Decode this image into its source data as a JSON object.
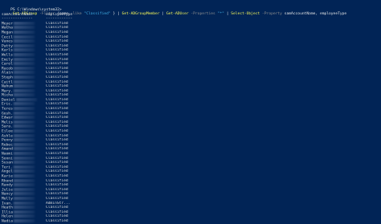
{
  "command": {
    "prompt": "PS C:\\Windows\\system32>",
    "tokens": [
      {
        "t": "cmd",
        "v": "Get-ADGroup"
      },
      {
        "t": "param",
        "v": "-Filter"
      },
      {
        "t": "op",
        "v": "{name"
      },
      {
        "t": "param",
        "v": "-like"
      },
      {
        "t": "str",
        "v": "\"Classified\""
      },
      {
        "t": "op",
        "v": "} |"
      },
      {
        "t": "cmd",
        "v": "Get-ADGroupMember"
      },
      {
        "t": "op",
        "v": "|"
      },
      {
        "t": "cmd",
        "v": "Get-ADUser"
      },
      {
        "t": "param",
        "v": "-Properties"
      },
      {
        "t": "str",
        "v": "\"*\""
      },
      {
        "t": "op",
        "v": "|"
      },
      {
        "t": "cmd",
        "v": "Select-Object"
      },
      {
        "t": "param",
        "v": "-Property"
      },
      {
        "t": "text",
        "v": "samAccountName, employeeType"
      }
    ]
  },
  "table": {
    "headers": [
      "samAccountName",
      "employeeType"
    ],
    "underline": [
      "--------------",
      "------------"
    ],
    "rows": [
      {
        "name": "Meyer",
        "type": "Classified"
      },
      {
        "name": "Watha",
        "type": "Classified"
      },
      {
        "name": "Megan",
        "type": "Classified"
      },
      {
        "name": "Cecil",
        "type": "Classified"
      },
      {
        "name": "Vanes",
        "type": "Classified"
      },
      {
        "name": "Patty",
        "type": "Classified"
      },
      {
        "name": "Karls",
        "type": "Classified"
      },
      {
        "name": "Wells",
        "type": "Classified"
      },
      {
        "name": "Emily",
        "type": "Classified"
      },
      {
        "name": "Carol",
        "type": "Classified"
      },
      {
        "name": "Racob",
        "type": "Classified"
      },
      {
        "name": "Alain",
        "type": "Classified"
      },
      {
        "name": "Steph",
        "type": "Classified"
      },
      {
        "name": "Caitl",
        "type": "Classified"
      },
      {
        "name": "Nahum",
        "type": "Classified"
      },
      {
        "name": "Mary.",
        "type": "Classified"
      },
      {
        "name": "Micha",
        "type": "Classified"
      },
      {
        "name": "Daniel",
        "type": "Classified"
      },
      {
        "name": "Eric.",
        "type": "Classified"
      },
      {
        "name": "Teres",
        "type": "Classified"
      },
      {
        "name": "Gosh.",
        "type": "Classified"
      },
      {
        "name": "Edwar",
        "type": "Classified"
      },
      {
        "name": "Melis",
        "type": "Classified"
      },
      {
        "name": "Sara.",
        "type": "Classified"
      },
      {
        "name": "Eilee",
        "type": "Classified"
      },
      {
        "name": "Ashle",
        "type": "Classified"
      },
      {
        "name": "Penny",
        "type": "Classified"
      },
      {
        "name": "Rebec",
        "type": "Classified"
      },
      {
        "name": "Amand",
        "type": "Classified"
      },
      {
        "name": "Naomi",
        "type": "Classified"
      },
      {
        "name": "Sonni",
        "type": "Classified"
      },
      {
        "name": "Susan",
        "type": "Classified"
      },
      {
        "name": "Teri.",
        "type": "Classified"
      },
      {
        "name": "Angel",
        "type": "Classified"
      },
      {
        "name": "Karie",
        "type": "Classified"
      },
      {
        "name": "Rhond",
        "type": "Classified"
      },
      {
        "name": "Randy",
        "type": "Classified"
      },
      {
        "name": "Julie",
        "type": "Classified"
      },
      {
        "name": "Nancy",
        "type": "Classified"
      },
      {
        "name": "Molly",
        "type": "Classified"
      },
      {
        "name": "Ivan.",
        "type": "AdminStr..."
      },
      {
        "name": "Heath",
        "type": "Classified"
      },
      {
        "name": "Illia",
        "type": "Classified"
      },
      {
        "name": "Helen",
        "type": "Classified"
      },
      {
        "name": "Nadia",
        "type": "Classified"
      }
    ]
  }
}
